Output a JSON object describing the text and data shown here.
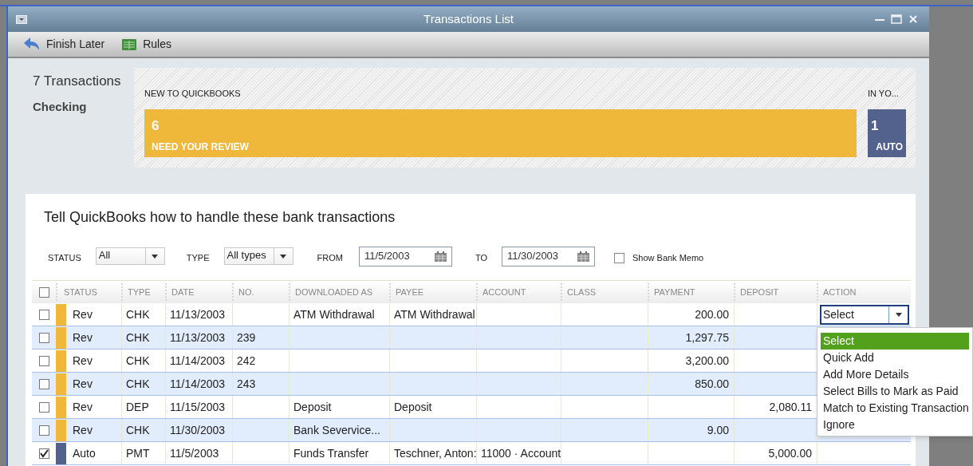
{
  "window": {
    "title": "Transactions List"
  },
  "toolbar": [
    {
      "label": "Finish Later",
      "kind": "back"
    },
    {
      "label": "Rules",
      "kind": "rules"
    }
  ],
  "summary": {
    "count": "7 Transactions",
    "account": "Checking",
    "review": {
      "heading": "NEW TO QUICKBOOKS",
      "number": "6",
      "label": "NEED YOUR REVIEW",
      "color": "#f0b83a"
    },
    "auto": {
      "heading": "IN YO...",
      "number": "1",
      "label": "AUTO",
      "color": "#52628c"
    }
  },
  "instructions": "Tell QuickBooks how to handle these bank transactions",
  "filters": {
    "status": {
      "label": "STATUS",
      "value": "All"
    },
    "type": {
      "label": "TYPE",
      "value": "All types"
    },
    "from": {
      "label": "FROM",
      "value": "11/5/2003"
    },
    "to": {
      "label": "TO",
      "value": "11/30/2003"
    },
    "show_bank_memo": {
      "label": "Show Bank Memo",
      "checked": false
    }
  },
  "table": {
    "all_checked": false,
    "columns": [
      "STATUS",
      "TYPE",
      "DATE",
      "NO.",
      "DOWNLOADED AS",
      "PAYEE",
      "ACCOUNT",
      "CLASS",
      "PAYMENT",
      "DEPOSIT",
      "ACTION"
    ],
    "rows": [
      {
        "checked": false,
        "color": "#f0b83a",
        "status": "Rev",
        "type": "CHK",
        "date": "11/13/2003",
        "no": "",
        "downloaded_as": "ATM Withdrawal",
        "payee": "ATM Withdrawal",
        "account": "",
        "payment": "200.00",
        "deposit": "",
        "action": "Select"
      },
      {
        "checked": false,
        "color": "#f0b83a",
        "status": "Rev",
        "type": "CHK",
        "date": "11/13/2003",
        "no": "239",
        "downloaded_as": "",
        "payee": "",
        "account": "",
        "payment": "1,297.75",
        "deposit": ""
      },
      {
        "checked": false,
        "color": "#f0b83a",
        "status": "Rev",
        "type": "CHK",
        "date": "11/14/2003",
        "no": "242",
        "downloaded_as": "",
        "payee": "",
        "account": "",
        "payment": "3,200.00",
        "deposit": ""
      },
      {
        "checked": false,
        "color": "#f0b83a",
        "status": "Rev",
        "type": "CHK",
        "date": "11/14/2003",
        "no": "243",
        "downloaded_as": "",
        "payee": "",
        "account": "",
        "payment": "850.00",
        "deposit": ""
      },
      {
        "checked": false,
        "color": "#f0b83a",
        "status": "Rev",
        "type": "DEP",
        "date": "11/15/2003",
        "no": "",
        "downloaded_as": "Deposit",
        "payee": "Deposit",
        "account": "",
        "payment": "",
        "deposit": "2,080.11"
      },
      {
        "checked": false,
        "color": "#f0b83a",
        "status": "Rev",
        "type": "CHK",
        "date": "11/30/2003",
        "no": "",
        "downloaded_as": "Bank Severvice...",
        "payee": "",
        "account": "",
        "payment": "9.00",
        "deposit": ""
      },
      {
        "checked": true,
        "color": "#52628c",
        "status": "Auto",
        "type": "PMT",
        "date": "11/5/2003",
        "no": "",
        "downloaded_as": "Funds Transfer",
        "payee": "Teschner, Anton:",
        "account": "11000 · Account",
        "payment": "",
        "deposit": "5,000.00"
      }
    ]
  },
  "action_menu": [
    {
      "label": "Select",
      "selected": true
    },
    {
      "label": "Quick Add",
      "selected": false
    },
    {
      "label": "Add More Details",
      "selected": false
    },
    {
      "label": "Select Bills to Mark as Paid",
      "selected": false
    },
    {
      "label": "Match to Existing Transaction",
      "selected": false
    },
    {
      "label": "Ignore",
      "selected": false
    }
  ]
}
